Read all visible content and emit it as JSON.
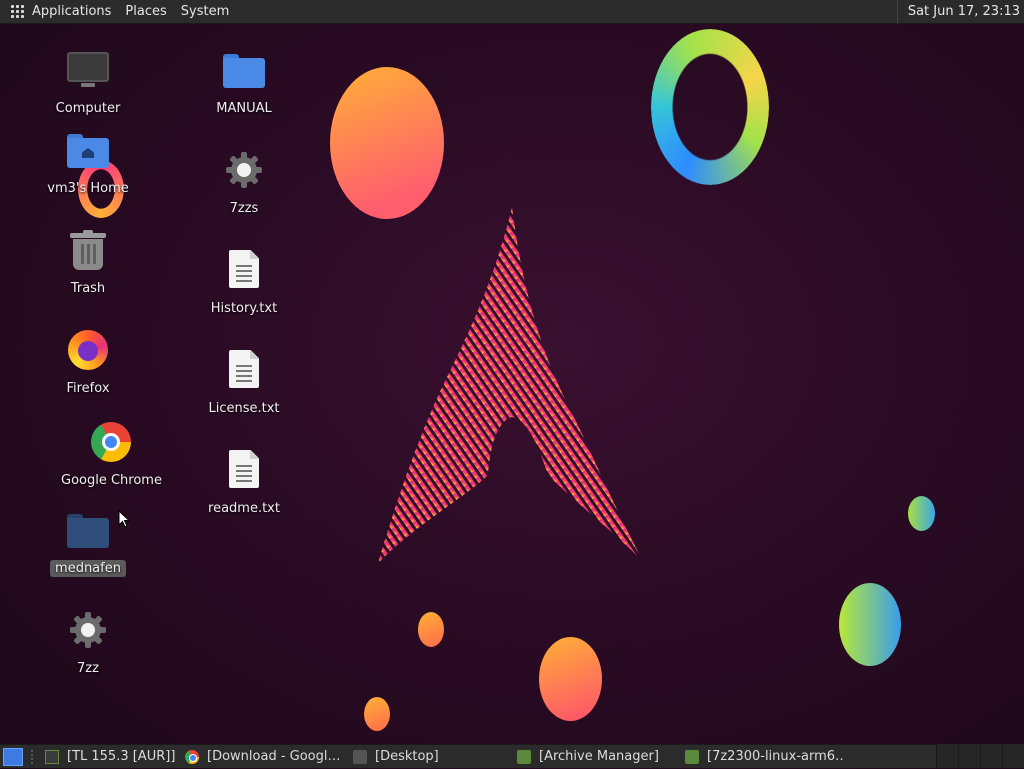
{
  "top_panel": {
    "menus": [
      "Applications",
      "Places",
      "System"
    ],
    "clock": "Sat Jun 17, 23:13"
  },
  "desktop": {
    "icons": [
      {
        "label": "Computer",
        "icon": "computer-icon"
      },
      {
        "label": "vm3's Home",
        "icon": "home-folder-icon"
      },
      {
        "label": "Trash",
        "icon": "trash-icon"
      },
      {
        "label": "Firefox",
        "icon": "firefox-icon"
      },
      {
        "label": "Google Chrome",
        "icon": "chrome-icon"
      },
      {
        "label": "mednafen",
        "icon": "folder-icon"
      },
      {
        "label": "7zz",
        "icon": "gear-icon"
      },
      {
        "label": "MANUAL",
        "icon": "folder-icon"
      },
      {
        "label": "7zzs",
        "icon": "gear-icon"
      },
      {
        "label": "History.txt",
        "icon": "text-file-icon"
      },
      {
        "label": "License.txt",
        "icon": "text-file-icon"
      },
      {
        "label": "readme.txt",
        "icon": "text-file-icon"
      }
    ]
  },
  "taskbar": {
    "tasks": [
      {
        "label": "[TL 155.3 [AUR]]",
        "icon": "terminal-icon"
      },
      {
        "label": "[Download - Googl…",
        "icon": "chrome-icon"
      },
      {
        "label": "[Desktop]",
        "icon": "desktop-icon"
      },
      {
        "label": "[Archive Manager]",
        "icon": "archive-icon"
      },
      {
        "label": "[7z2300-linux-arm6…",
        "icon": "archive-icon"
      }
    ]
  },
  "colors": {
    "panel": "#2b2b2b",
    "folder_blue": "#4a8ae6",
    "folder_dark": "#2f4f7a",
    "accent_pink": "#e8327a"
  }
}
